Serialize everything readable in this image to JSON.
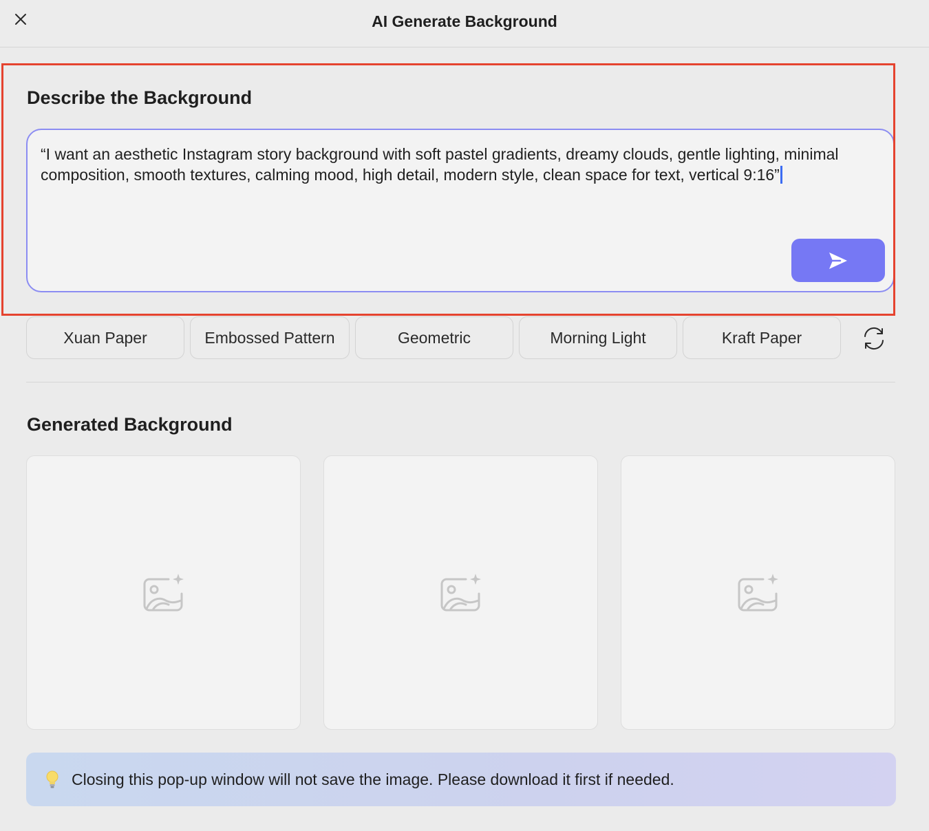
{
  "window": {
    "title": "AI Generate Background"
  },
  "describe": {
    "heading": "Describe the Background",
    "prompt_text": "“I want an aesthetic Instagram story background with soft pastel gradients, dreamy clouds, gentle lighting, minimal composition, smooth textures, calming mood, high detail, modern style, clean space for text, vertical 9:16”"
  },
  "styles": [
    {
      "label": "Xuan Paper"
    },
    {
      "label": "Embossed Pattern"
    },
    {
      "label": "Geometric"
    },
    {
      "label": "Morning Light"
    },
    {
      "label": "Kraft Paper"
    }
  ],
  "generated": {
    "heading": "Generated Background"
  },
  "notice": {
    "text": "Closing this pop-up window will not save the image. Please download it first if needed."
  },
  "icons": {
    "close": "close-icon",
    "send": "send-icon",
    "refresh": "refresh-icon",
    "placeholder": "ai-image-placeholder-icon",
    "notice": "lightbulb-icon"
  },
  "colors": {
    "accent": "#7678f4",
    "highlight_border": "#e5432f",
    "prompt_border": "#8b8cf2"
  }
}
